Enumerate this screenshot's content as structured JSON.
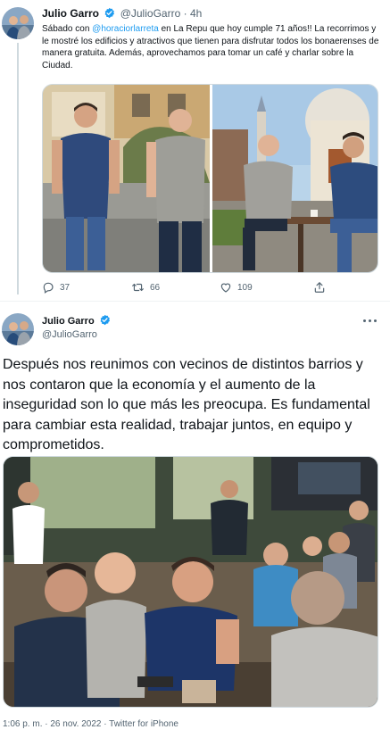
{
  "tweet1": {
    "author_name": "Julio Garro",
    "handle": "@JulioGarro",
    "separator": "·",
    "time": "4h",
    "text_before": "Sábado con ",
    "mention": "@horaciorlarreta",
    "text_after": " en La Repu que hoy cumple 71 años!! La recorrimos y le mostré los edificios y atractivos que tienen para disfrutar todos los bonaerenses de manera gratuita. Además, aprovechamos para tomar un café y charlar sobre la Ciudad.",
    "replies": "37",
    "retweets": "66",
    "likes": "109"
  },
  "tweet2": {
    "author_name": "Julio Garro",
    "handle": "@JulioGarro",
    "text": "Después nos reunimos con vecinos de distintos barrios y nos contaron que la economía y el aumento de la inseguridad son lo que más les preocupa. Es fundamental para cambiar esta realidad, trabajar juntos, en equipo y comprometidos.",
    "timestamp": "1:06 p. m. · 26 nov. 2022 · Twitter for iPhone"
  },
  "colors": {
    "accent": "#1d9bf0",
    "text": "#0f1419",
    "muted": "#536471",
    "border": "#cfd9de"
  },
  "icons": {
    "verified": "verified-badge-icon",
    "reply": "reply-icon",
    "retweet": "retweet-icon",
    "like": "heart-icon",
    "share": "share-icon",
    "more": "more-icon"
  }
}
